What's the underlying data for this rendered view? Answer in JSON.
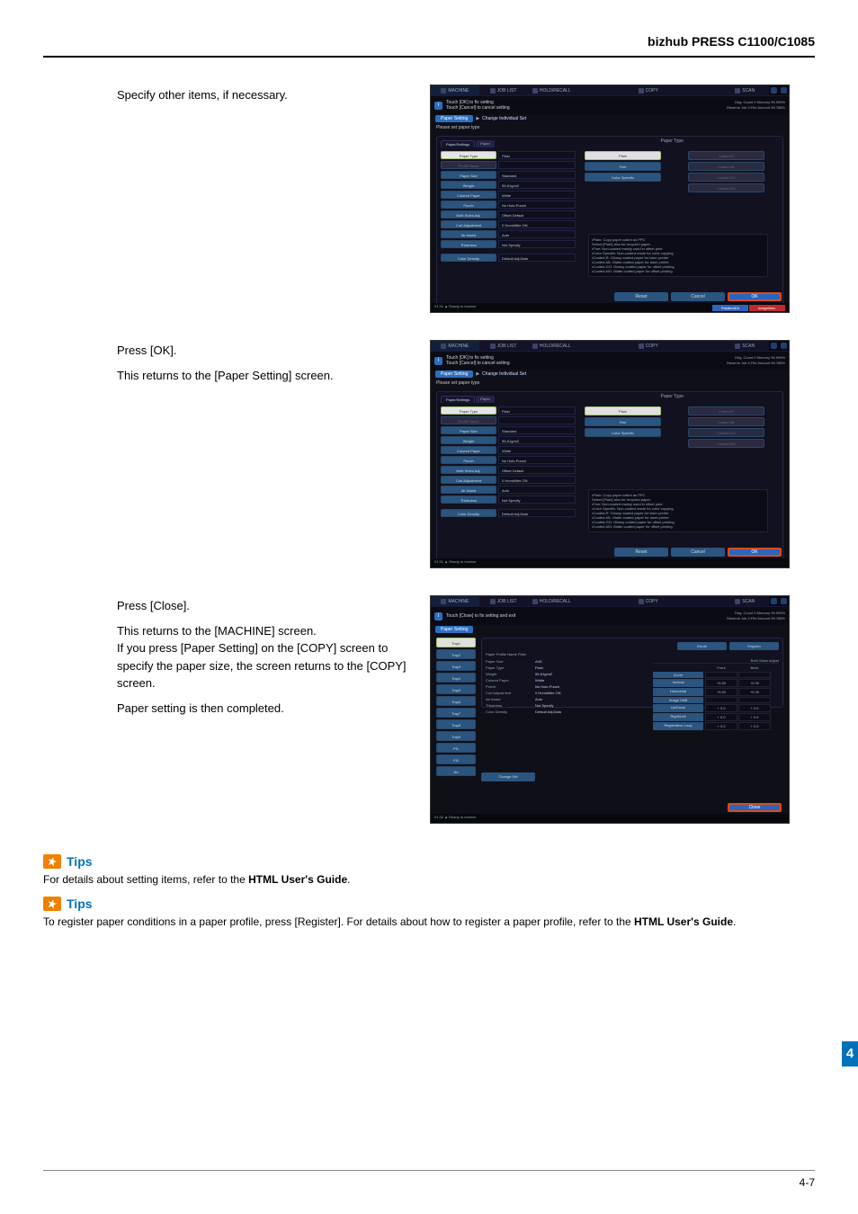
{
  "header": {
    "model": "bizhub PRESS C1100/C1085"
  },
  "section1": {
    "step": "Specify other items, if necessary."
  },
  "section2": {
    "step": "Press [OK].",
    "desc": "This returns to the [Paper Setting] screen."
  },
  "section3": {
    "step": "Press [Close].",
    "l1": "This returns to the [MACHINE] screen.",
    "l2": "If you press [Paper Setting] on the [COPY] screen to specify the paper size, the screen returns to the [COPY] screen.",
    "l3": "Paper setting is then completed."
  },
  "tips": {
    "label": "Tips",
    "t1a": "For details about setting items, refer to the ",
    "t1b": "HTML User's Guide",
    "t1c": ".",
    "t2a": "To register paper conditions in a paper profile, press [Register]. For details about how to register a paper profile, refer to the ",
    "t2b": "HTML User's Guide",
    "t2c": "."
  },
  "footer": {
    "page": "4-7"
  },
  "sidebar": {
    "num": "4"
  },
  "shot_common": {
    "tabs": [
      "MACHINE",
      "JOB LIST",
      "HOLD/RECALL",
      "",
      "COPY",
      "",
      "SCAN"
    ],
    "help": "?",
    "info_line1": "Touch [OK] to fix setting",
    "info_line2": "Touch [Cancel] to cancel setting",
    "mem1": "Orig. Count      0  Memory     99.999%",
    "mem2": "Reserve Job      0  File Amount  99.788%",
    "crumb": {
      "a": "Paper Setting",
      "sep": "▶",
      "b": "Change Individual Set"
    },
    "sub": "Please set paper type",
    "panel_title": "Paper Type",
    "tabstrip": {
      "a": "Paper/Settings",
      "b": "Paper"
    },
    "left_rows": [
      {
        "lab": "Paper Type",
        "val": "Plain",
        "sel": true
      },
      {
        "lab": "Profile Name",
        "val": "",
        "dim": true
      },
      {
        "lab": "Paper Size",
        "val": "Standard"
      },
      {
        "lab": "Weight",
        "val": "55-61g/m2"
      },
      {
        "lab": "Colored Paper",
        "val": "White"
      },
      {
        "lab": "Punch",
        "val": "No Hole-Punch"
      },
      {
        "lab": "Both Sides Adj.",
        "val": "Offset Default"
      },
      {
        "lab": "Curl Adjustment",
        "val": "0  Humidifier ON"
      },
      {
        "lab": "Air Assist",
        "val": "Auto"
      },
      {
        "lab": "Thickness",
        "val": "Not Specify"
      },
      {
        "lab": "Color Density",
        "val": "Default Adj.Data"
      }
    ],
    "right_btns": [
      {
        "t": "Plain",
        "sel": true
      },
      {
        "t": "Fine",
        "sel": false
      },
      {
        "t": "Color Specific",
        "sel": false
      }
    ],
    "coated": [
      "Coated-R",
      "Coated-ML",
      "Coated-GO",
      "Coated-MO"
    ],
    "notes": [
      "•Plain: Copy paper called as PPC",
      " Select [Plain] also for recycled paper.",
      "•Fine: Non-coated mainly used in offset print",
      "•Color Specific: Non-coated made for color copying",
      "•Coated-R: Glossy coated paper for laser printer",
      "•Coated-ML: Matte coated paper for laser printer",
      "•Coated-GO: Glossy coated paper for offset printing",
      "•Coated-MO: Matte coated paper for offset printing"
    ],
    "btns": {
      "reset": "Reset",
      "cancel": "Cancel",
      "ok": "OK"
    },
    "chips": {
      "b": "RotationDir",
      "r": "ImageMan."
    },
    "status": {
      "l": "01:31  ▲ Ready to receive",
      "r": ""
    }
  },
  "shot3": {
    "info": "Touch [Close] to fix setting and exit",
    "crumb_a": "Paper Setting",
    "trays": [
      "Tray1",
      "Tray2",
      "Tray3",
      "Tray4",
      "Tray5",
      "Tray6",
      "Tray7",
      "Tray8",
      "Tray9",
      "PI1",
      "PI2",
      "No"
    ],
    "tray_sel": 0,
    "recall": "Recall",
    "register": "Register",
    "pp_title": "Paper Profile Name  Plain",
    "props": [
      [
        "Paper Size",
        "A4D"
      ],
      [
        "Paper Type",
        "Plain"
      ],
      [
        "Weight",
        "55-61g/m2"
      ],
      [
        "Colored Paper",
        "White"
      ],
      [
        "Punch",
        "No Hole-Punch"
      ],
      [
        "Curl Adjustment",
        "0  Humidifier ON"
      ],
      [
        "Air Assist",
        "Auto"
      ],
      [
        "Thickness",
        "Not Specify"
      ],
      [
        "Color Density",
        "Default Adj.Data"
      ]
    ],
    "adj_title": "Both Sides Adjust",
    "adj_cols": [
      "Front",
      "Back"
    ],
    "adj_rows": [
      [
        "Zoom",
        "",
        ""
      ],
      [
        "Vertical",
        "+0.00",
        "+0.00"
      ],
      [
        "Horizontal",
        "+0.00",
        "+0.00"
      ],
      [
        "Image Shift",
        "",
        ""
      ],
      [
        "Up/Down",
        "+ 0.0",
        "+ 0.0"
      ],
      [
        "Right/Left",
        "+ 0.0",
        "+ 0.0"
      ],
      [
        "Registration Loop",
        "+ 0.0",
        "+ 0.0"
      ]
    ],
    "change_set": "Change Set",
    "close": "Close",
    "status": "01:32  ▲ Ready to receive"
  }
}
